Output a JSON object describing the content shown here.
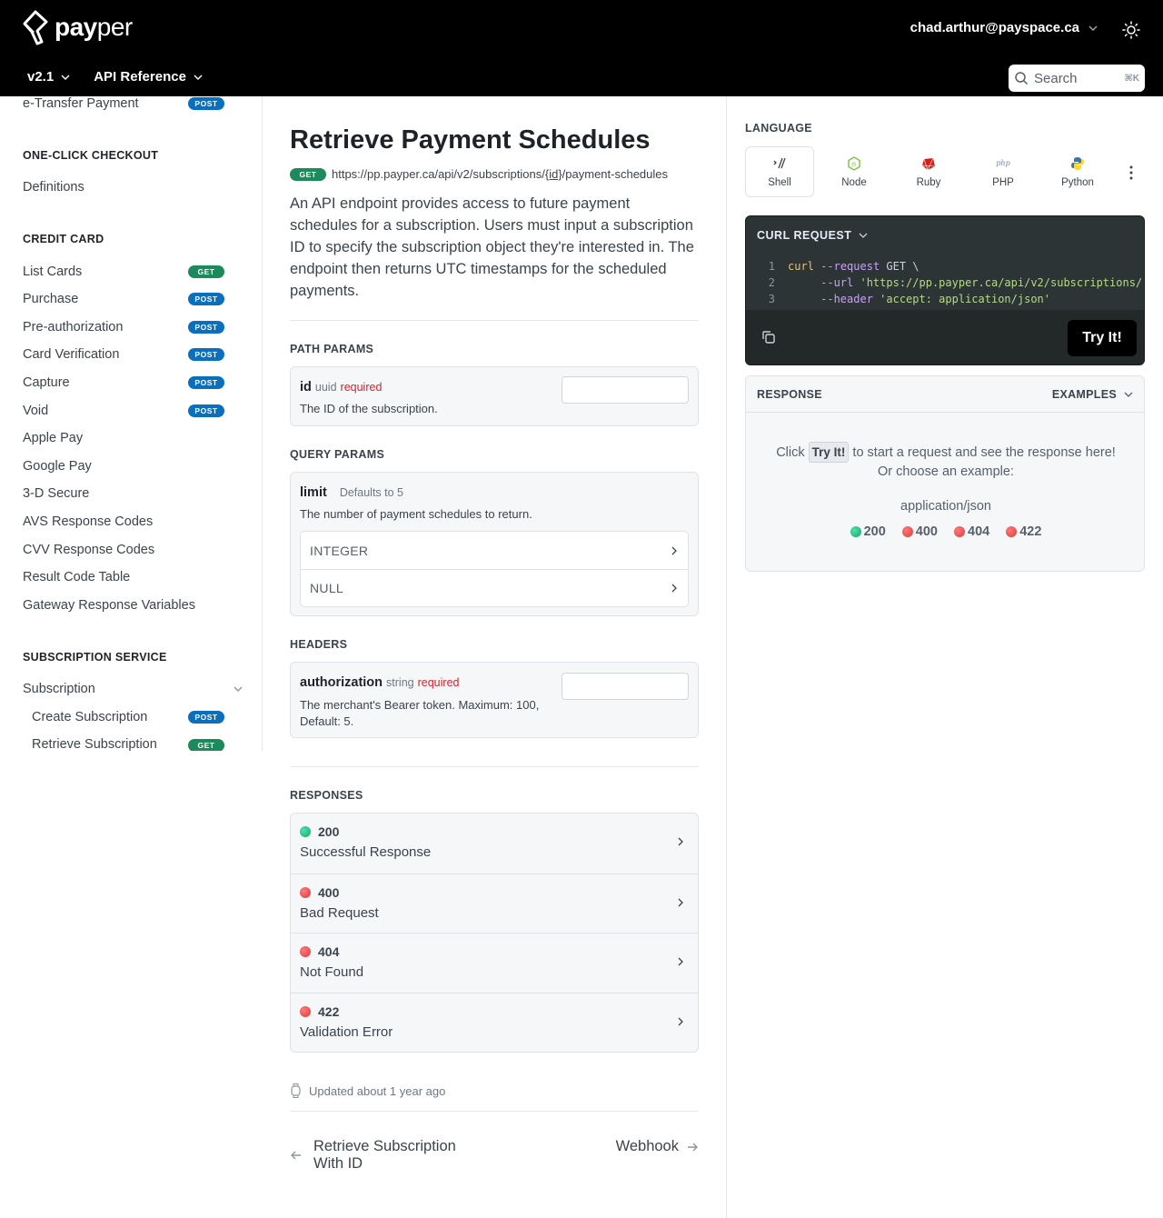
{
  "header": {
    "brand_bold": "pay",
    "brand_light": "per",
    "user_email": "chad.arthur@payspace.ca",
    "version": "v2.1",
    "section": "API Reference",
    "search_placeholder": "Search",
    "search_shortcut": "⌘K"
  },
  "sidebar": {
    "top_item": {
      "label": "e-Transfer Payment",
      "method": "POST"
    },
    "sections": [
      {
        "heading": "ONE-CLICK CHECKOUT",
        "items": [
          {
            "label": "Definitions"
          }
        ]
      },
      {
        "heading": "CREDIT CARD",
        "items": [
          {
            "label": "List Cards",
            "method": "GET"
          },
          {
            "label": "Purchase",
            "method": "POST"
          },
          {
            "label": "Pre-authorization",
            "method": "POST"
          },
          {
            "label": "Card Verification",
            "method": "POST"
          },
          {
            "label": "Capture",
            "method": "POST"
          },
          {
            "label": "Void",
            "method": "POST"
          },
          {
            "label": "Apple Pay"
          },
          {
            "label": "Google Pay"
          },
          {
            "label": "3-D Secure"
          },
          {
            "label": "AVS Response Codes"
          },
          {
            "label": "CVV Response Codes"
          },
          {
            "label": "Result Code Table"
          },
          {
            "label": "Gateway Response Variables"
          }
        ]
      },
      {
        "heading": "SUBSCRIPTION SERVICE",
        "items": [
          {
            "label": "Subscription"
          },
          {
            "label": "Create Subscription",
            "method": "POST"
          },
          {
            "label": "Retrieve Subscription",
            "method": "GET"
          }
        ]
      }
    ]
  },
  "page": {
    "title": "Retrieve Payment Schedules",
    "method": "GET",
    "url_prefix": "https://pp.payper.ca/api/v2/subscriptions/",
    "url_param": "{id}",
    "url_suffix": "/payment-schedules",
    "description": "An API endpoint provides access to future payment schedules for a subscription. Users must input a subscription ID to specify the subscription object they're interested in. The endpoint then returns UTC timestamps for the scheduled payments."
  },
  "path_params": {
    "label": "PATH PARAMS",
    "name": "id",
    "type": "uuid",
    "required": "required",
    "desc": "The ID of the subscription."
  },
  "query_params": {
    "label": "QUERY PARAMS",
    "name": "limit",
    "default": "Defaults to 5",
    "desc": "The number of payment schedules to return.",
    "types": [
      "INTEGER",
      "NULL"
    ]
  },
  "headers": {
    "label": "HEADERS",
    "name": "authorization",
    "type": "string",
    "required": "required",
    "desc": "The merchant's Bearer token. Maximum: 100, Default: 5."
  },
  "responses": {
    "label": "RESPONSES",
    "items": [
      {
        "code": "200",
        "text": "Successful Response",
        "status": "success"
      },
      {
        "code": "400",
        "text": "Bad Request",
        "status": "error"
      },
      {
        "code": "404",
        "text": "Not Found",
        "status": "error"
      },
      {
        "code": "422",
        "text": "Validation Error",
        "status": "error"
      }
    ]
  },
  "footer": {
    "updated": "Updated about 1 year ago",
    "prev_line1": "Retrieve Subscription",
    "prev_line2": "With ID",
    "next": "Webhook"
  },
  "right_panel": {
    "language_label": "LANGUAGE",
    "languages": [
      "Shell",
      "Node",
      "Ruby",
      "PHP",
      "Python"
    ],
    "active_language": "Shell",
    "code_title": "CURL REQUEST",
    "code": {
      "l1_cmd": "curl",
      "l1_flag": "--request",
      "l1_rest": " GET \\",
      "l2_flag": "--url",
      "l2_str": "'https://pp.payper.ca/api/v2/subscriptions/",
      "l3_flag": "--header",
      "l3_str": "'accept: application/json'"
    },
    "try_label": "Try It!",
    "response_label": "RESPONSE",
    "examples_label": "EXAMPLES",
    "hint_before": "Click ",
    "hint_try": "Try It!",
    "hint_after": " to start a request and see the response here!",
    "hint_line2": "Or choose an example:",
    "mime": "application/json",
    "example_codes": [
      {
        "code": "200",
        "status": "success"
      },
      {
        "code": "400",
        "status": "error"
      },
      {
        "code": "404",
        "status": "error"
      },
      {
        "code": "422",
        "status": "error"
      }
    ]
  },
  "colors": {
    "post_badge": "#0b6fbf",
    "get_badge": "#1c8a5b",
    "success": "#14a86b",
    "error": "#d93b3b",
    "header_bg": "#000000",
    "code_bg": "#2d3436"
  }
}
